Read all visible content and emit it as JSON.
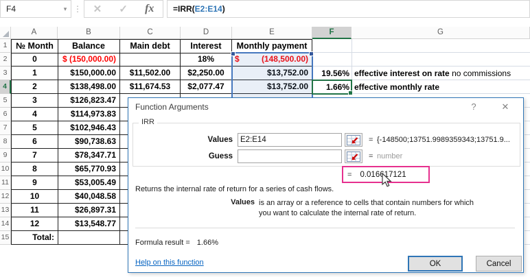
{
  "colors": {
    "accent_green": "#217346",
    "selection_blue": "#4577be",
    "negative_red": "#ff0000",
    "link_blue": "#0563c1",
    "result_box_pink": "#e6308e",
    "dialog_border_blue": "#2e75b6",
    "gridline": "#d5dbe4"
  },
  "formula_bar": {
    "cell_reference": "F4",
    "name_box_dropdown": "▾",
    "separator_dots": "⋮",
    "cancel_icon": "✕",
    "enter_icon": "✓",
    "insert_function_icon": "fx",
    "formula_prefix": "=IRR(",
    "formula_range": "E2:E14",
    "formula_suffix": ")"
  },
  "sheet": {
    "column_headers": [
      "A",
      "B",
      "C",
      "D",
      "E",
      "F",
      "G"
    ],
    "row_headers": [
      "1",
      "2",
      "3",
      "4",
      "5",
      "6",
      "7",
      "8",
      "9",
      "10",
      "11",
      "12",
      "13",
      "14",
      "15"
    ],
    "active_column": "F",
    "active_row": "4",
    "table": {
      "rows": [
        [
          "№ Month",
          "Balance",
          "Main debt",
          "Interest",
          "Monthly payment"
        ],
        [
          "0",
          "$ (150,000.00)",
          "",
          "18%",
          {
            "sym": "$",
            "amount": "(148,500.00)"
          }
        ],
        [
          "1",
          "$150,000.00",
          "$11,502.00",
          "$2,250.00",
          "$13,752.00"
        ],
        [
          "2",
          "$138,498.00",
          "$11,674.53",
          "$2,077.47",
          "$13,752.00"
        ],
        [
          "3",
          "$126,823.47",
          "",
          "",
          ""
        ],
        [
          "4",
          "$114,973.83",
          "",
          "",
          ""
        ],
        [
          "5",
          "$102,946.43",
          "",
          "",
          ""
        ],
        [
          "6",
          "$90,738.63",
          "",
          "",
          ""
        ],
        [
          "7",
          "$78,347.71",
          "",
          "",
          ""
        ],
        [
          "8",
          "$65,770.93",
          "",
          "",
          ""
        ],
        [
          "9",
          "$53,005.49",
          "",
          "",
          ""
        ],
        [
          "10",
          "$40,048.58",
          "",
          "",
          ""
        ],
        [
          "11",
          "$26,897.31",
          "",
          "",
          ""
        ],
        [
          "12",
          "$13,548.77",
          "",
          "",
          ""
        ],
        [
          "Total:",
          "",
          "",
          "",
          ""
        ]
      ]
    },
    "extras": {
      "f3": "19.56%",
      "g3_bold": "effective interest on rate",
      "g3_normal": "no commissions",
      "f4": "1.66%",
      "g4": "effective monthly rate"
    }
  },
  "dialog": {
    "title": "Function Arguments",
    "help_button": "?",
    "close_button": "✕",
    "group_label": "IRR",
    "values_label": "Values",
    "values_input": "E2:E14",
    "values_equals": "=",
    "values_result": "{-148500;13751.9989359343;13751.9...",
    "guess_label": "Guess",
    "guess_input": "",
    "guess_equals": "=",
    "guess_result": "number",
    "result_equals": "=",
    "result_value": "0.016617121",
    "description": "Returns the internal rate of return for a series of cash flows.",
    "arg_name": "Values",
    "arg_description": "is an array or a reference to cells that contain numbers for which you want to calculate the internal rate of return.",
    "formula_result_label": "Formula result =",
    "formula_result_value": "1.66%",
    "help_link": "Help on this function",
    "ok_button": "OK",
    "cancel_button": "Cancel"
  }
}
